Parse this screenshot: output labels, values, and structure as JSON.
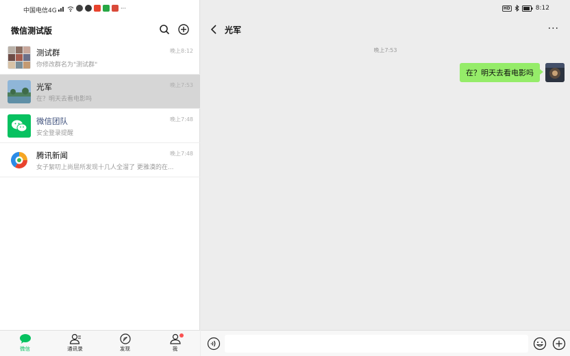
{
  "status_left": {
    "carrier": "中国电信4G"
  },
  "status_right": {
    "time": "8:12",
    "hd": "HD"
  },
  "app": {
    "title": "微信测试版"
  },
  "chats": [
    {
      "name": "测试群",
      "preview": "你修改群名为\"测试群\"",
      "time": "晚上8:12",
      "avatar": "group-avatar"
    },
    {
      "name": "光军",
      "preview": "在？明天去看电影吗",
      "time": "晚上7:53",
      "avatar": "landscape-avatar"
    },
    {
      "name": "微信团队",
      "preview": "安全登录提醒",
      "time": "晚上7:48",
      "avatar": "wechat-logo-avatar"
    },
    {
      "name": "腾讯新闻",
      "preview": "女子絮叨上尚层所发现十几人全溜了 更雅漠的在...",
      "time": "晚上7:48",
      "avatar": "tencent-news-avatar"
    }
  ],
  "tabs": [
    {
      "label": "微信",
      "icon": "chat-bubble-icon"
    },
    {
      "label": "通讯录",
      "icon": "contacts-icon"
    },
    {
      "label": "发现",
      "icon": "compass-icon"
    },
    {
      "label": "我",
      "icon": "person-icon"
    }
  ],
  "conversation": {
    "title": "光军",
    "time": "晚上7:53",
    "messages": [
      {
        "text": "在？明天去看电影吗",
        "from": "me"
      }
    ],
    "more": "···"
  },
  "input": {
    "value": ""
  },
  "colors": {
    "accent": "#07c160",
    "bubble": "#95ec69",
    "badge": "#fa5151"
  }
}
